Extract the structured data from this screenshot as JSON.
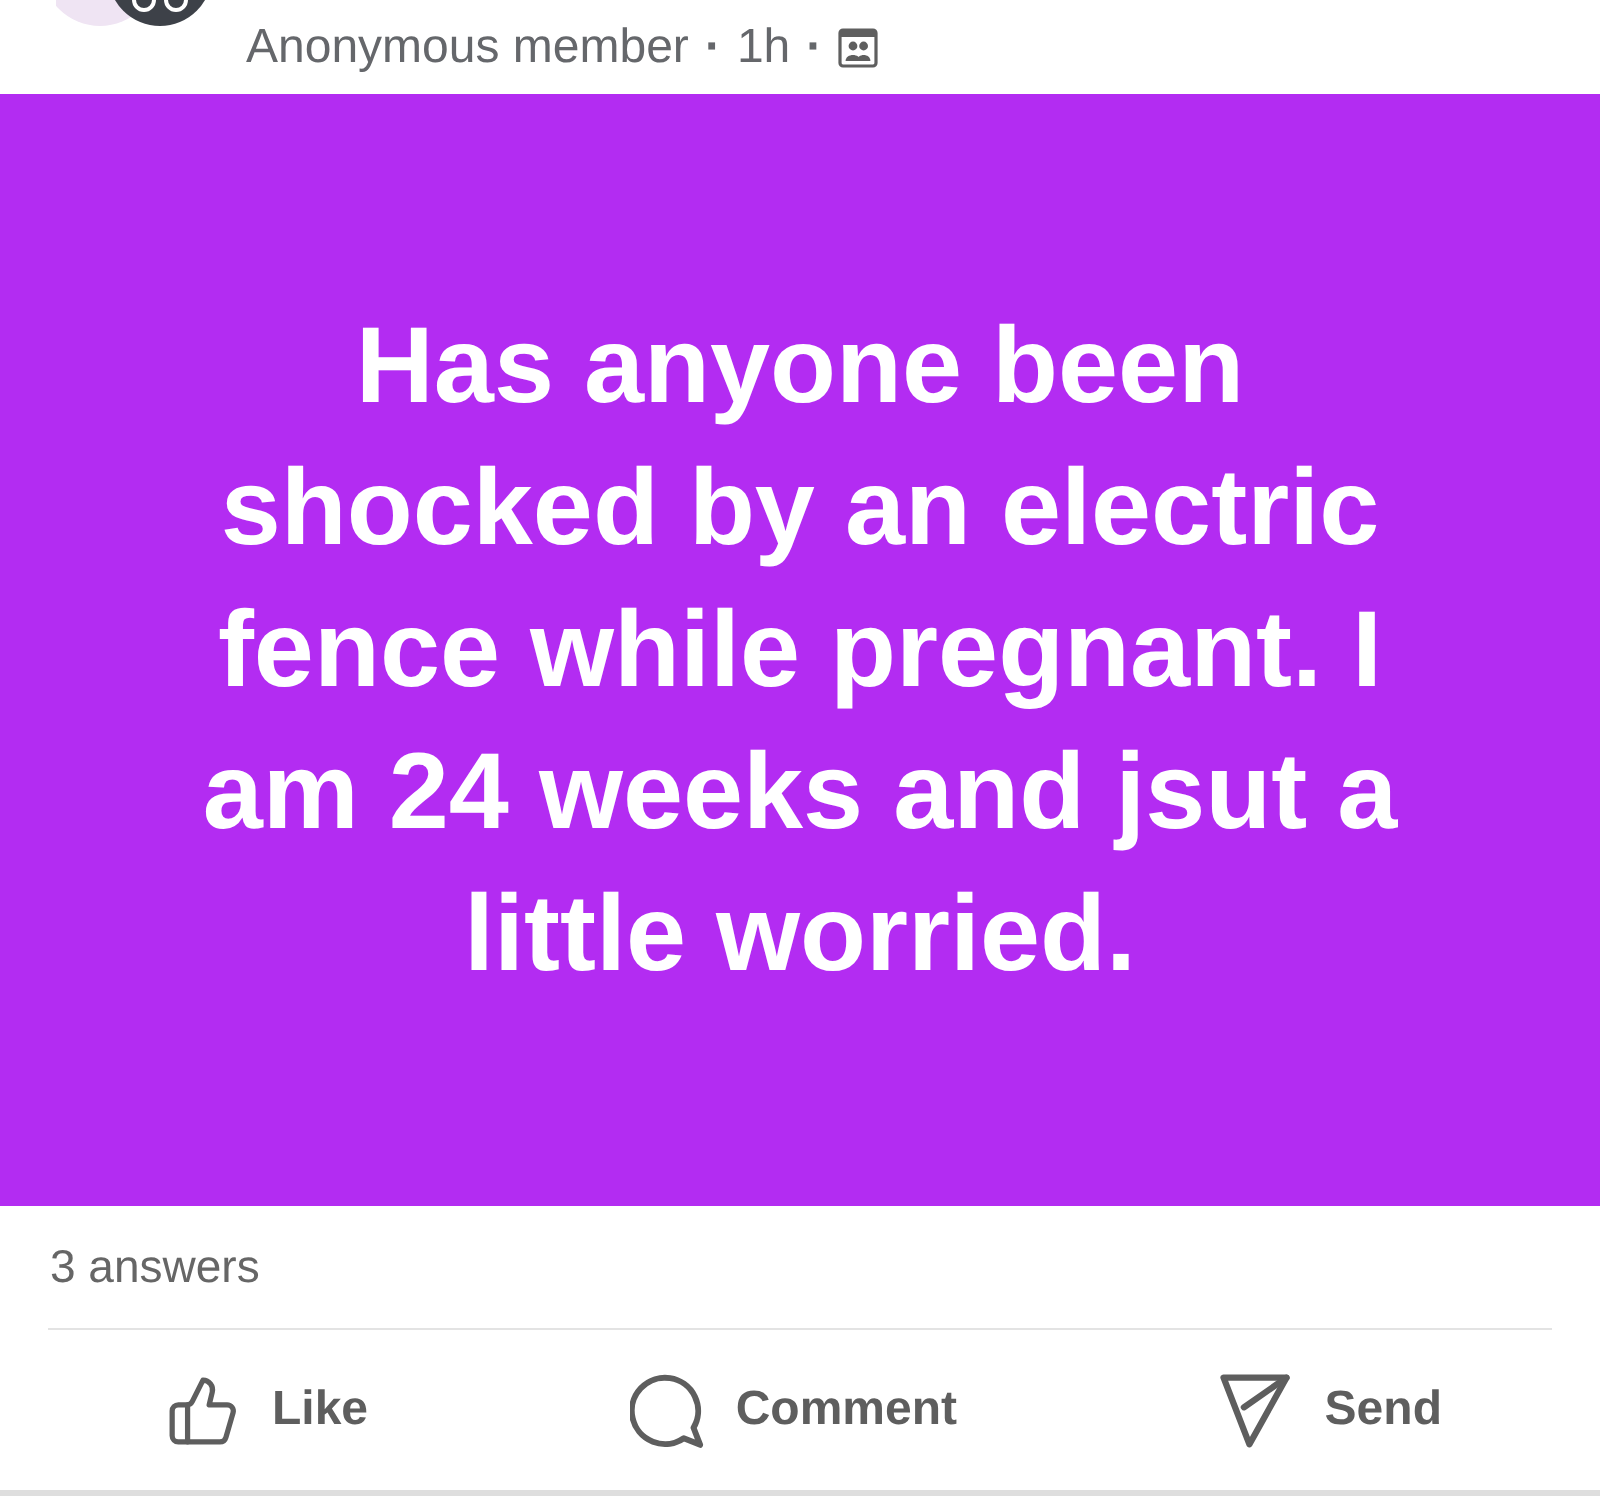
{
  "header": {
    "meta": [
      {
        "kind": "author",
        "text": "Anonymous member"
      },
      {
        "kind": "separator",
        "text": "·"
      },
      {
        "kind": "time",
        "text": "1h"
      },
      {
        "kind": "separator",
        "text": "·"
      }
    ]
  },
  "post": {
    "text": "Has anyone been shocked by an electric fence while pregnant. I am 24 weeks and jsut a little worried."
  },
  "answers_count": "3 answers",
  "actions": [
    {
      "kind": "like",
      "label": "Like"
    },
    {
      "kind": "comment",
      "label": "Comment"
    },
    {
      "kind": "send",
      "label": "Send"
    }
  ]
}
